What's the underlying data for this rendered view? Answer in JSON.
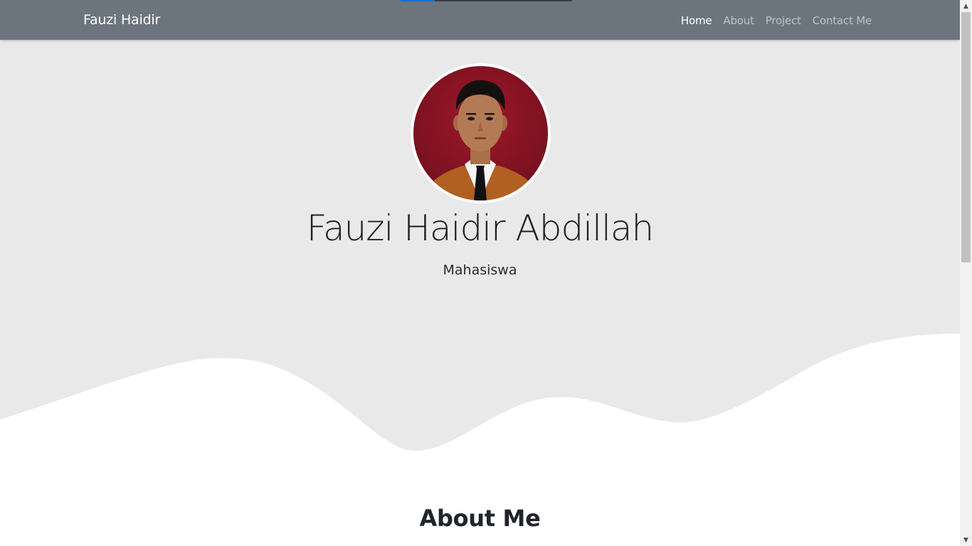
{
  "navbar": {
    "brand": "Fauzi Haidir",
    "links": [
      {
        "label": "Home",
        "active": true
      },
      {
        "label": "About",
        "active": false
      },
      {
        "label": "Project",
        "active": false
      },
      {
        "label": "Contact Me",
        "active": false
      }
    ],
    "bg_color": "#6c757d"
  },
  "hero": {
    "name": "Fauzi Haidir Abdillah",
    "role": "Mahasiswa",
    "bg_color": "#e9e9e9",
    "avatar_icon": "profile-photo"
  },
  "about": {
    "title": "About Me"
  },
  "scrollbar": {
    "up_icon": "chevron-up-icon",
    "down_icon": "chevron-down-icon"
  }
}
